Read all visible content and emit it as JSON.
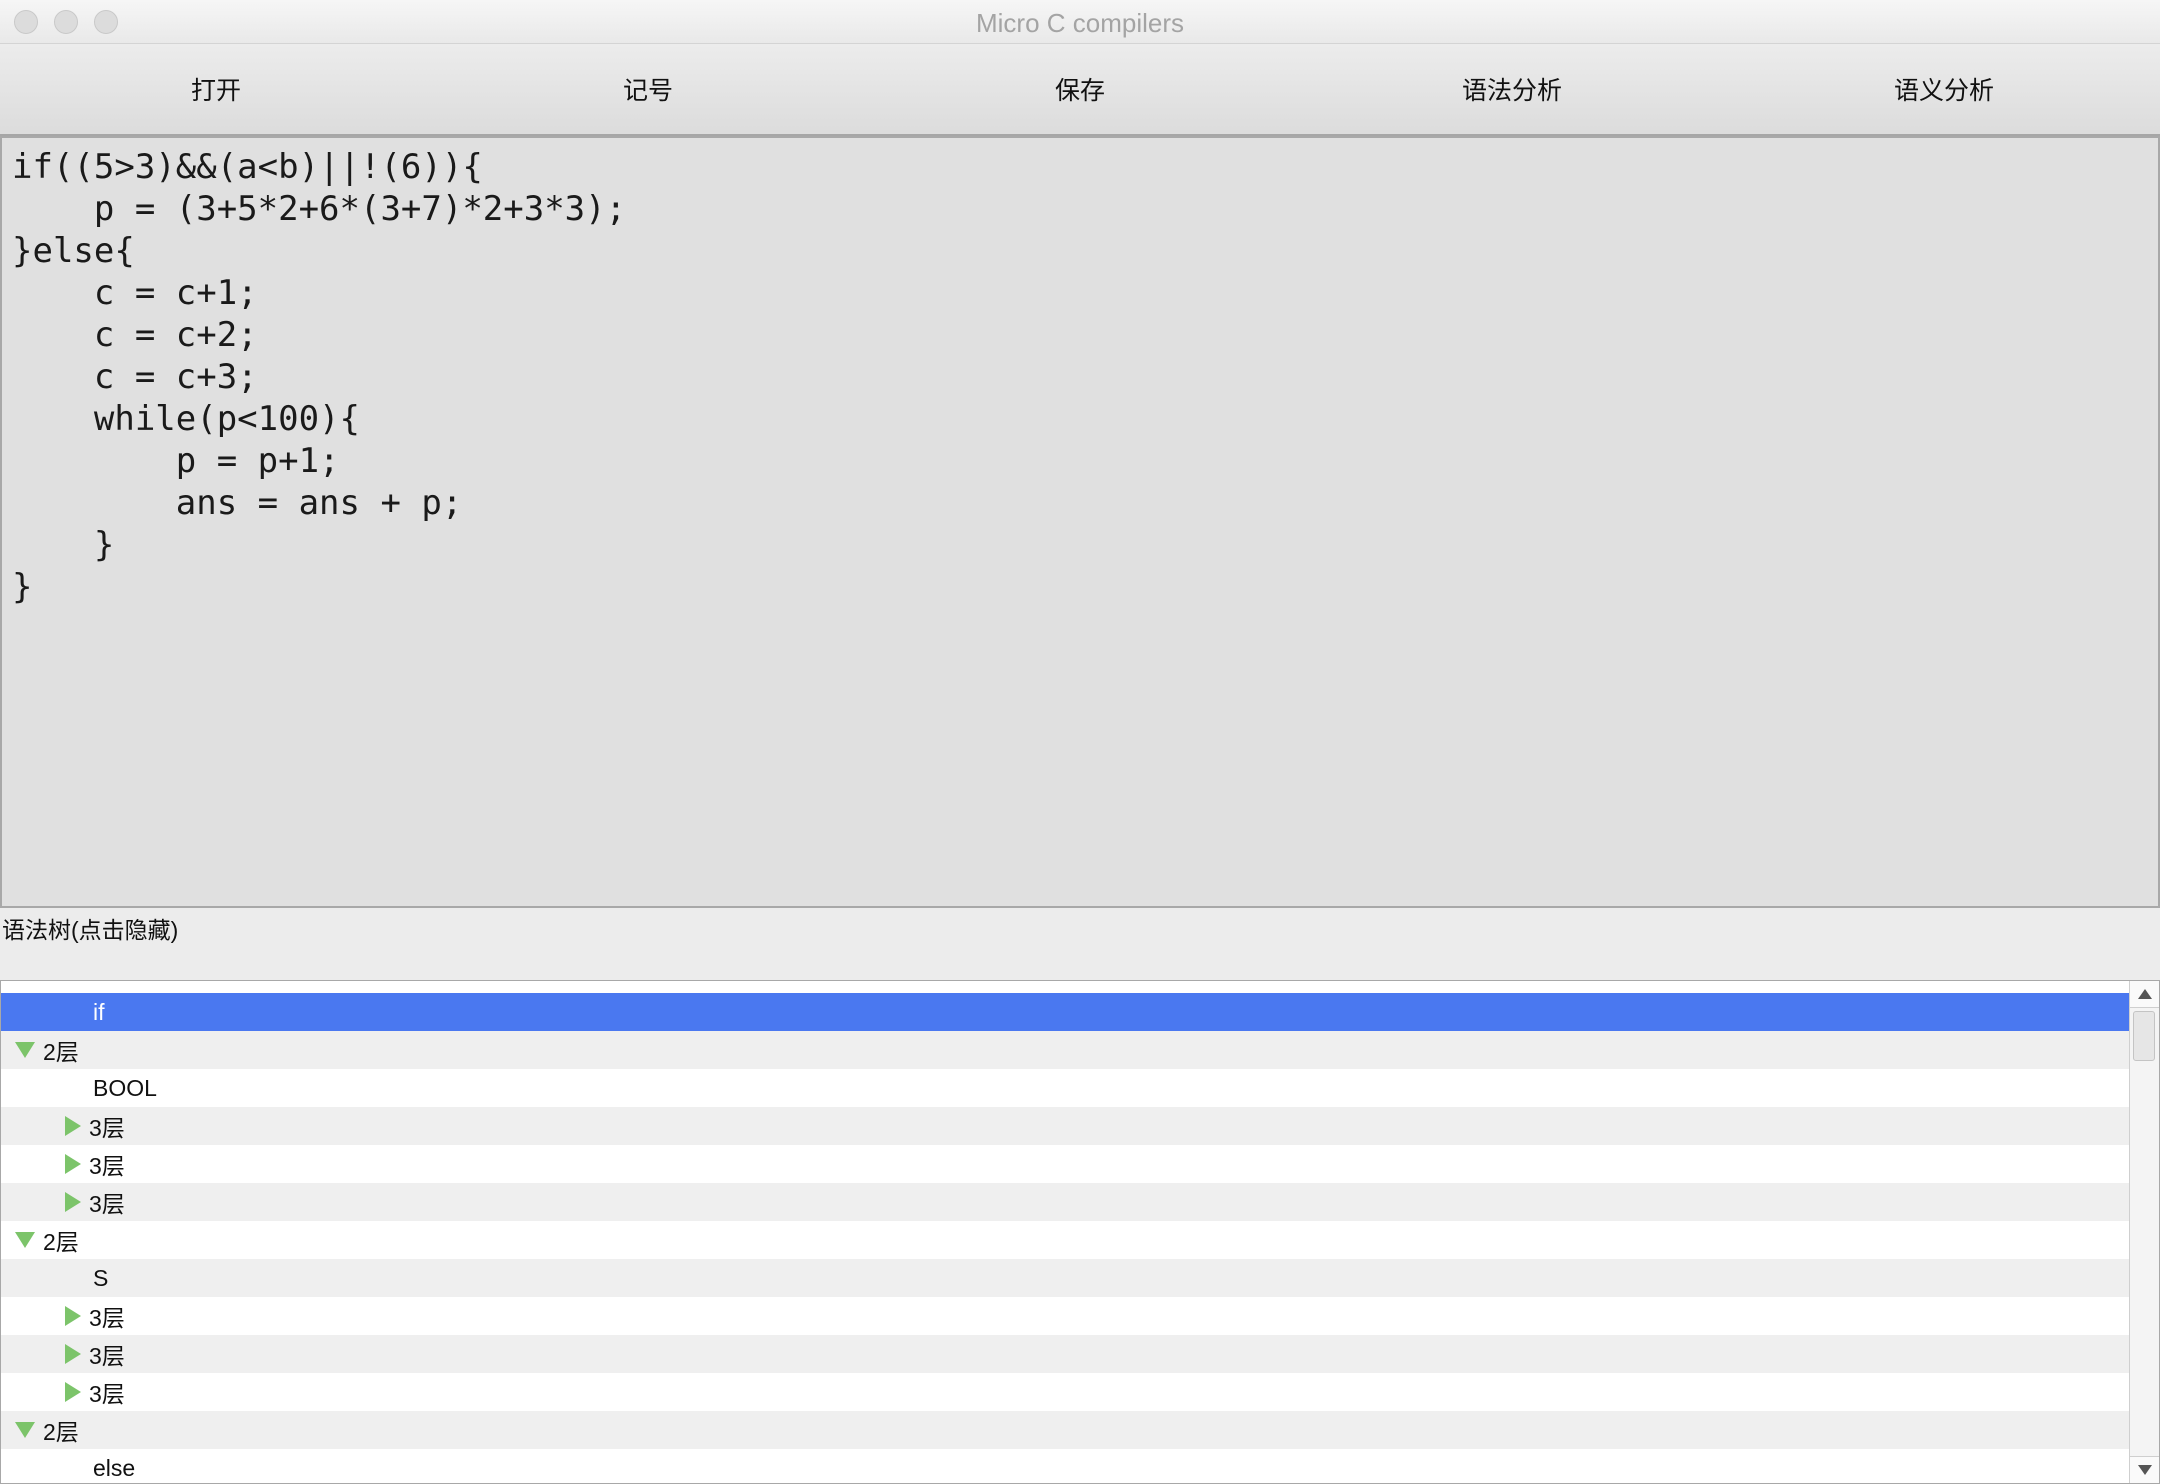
{
  "window": {
    "title": "Micro C compilers"
  },
  "toolbar": {
    "open_label": "打开",
    "tokens_label": "记号",
    "save_label": "保存",
    "syntax_label": "语法分析",
    "semantic_label": "语义分析"
  },
  "editor": {
    "code": "if((5>3)&&(a<b)||!(6)){\n    p = (3+5*2+6*(3+7)*2+3*3);\n}else{\n    c = c+1;\n    c = c+2;\n    c = c+3;\n    while(p<100){\n        p = p+1;\n        ans = ans + p;\n    }\n}"
  },
  "tree_label": "语法树(点击隐藏)",
  "tree": {
    "rows": [
      {
        "label": "if",
        "selected": true
      },
      {
        "label": "2层",
        "expanded": true
      },
      {
        "label": "BOOL"
      },
      {
        "label": "3层",
        "expanded": false
      },
      {
        "label": "3层",
        "expanded": false
      },
      {
        "label": "3层",
        "expanded": false
      },
      {
        "label": "2层",
        "expanded": true
      },
      {
        "label": "S"
      },
      {
        "label": "3层",
        "expanded": false
      },
      {
        "label": "3层",
        "expanded": false
      },
      {
        "label": "3层",
        "expanded": false
      },
      {
        "label": "2层",
        "expanded": true
      },
      {
        "label": "else"
      }
    ]
  },
  "colors": {
    "selection": "#4a78f0",
    "disclosure": "#7cc46a"
  }
}
